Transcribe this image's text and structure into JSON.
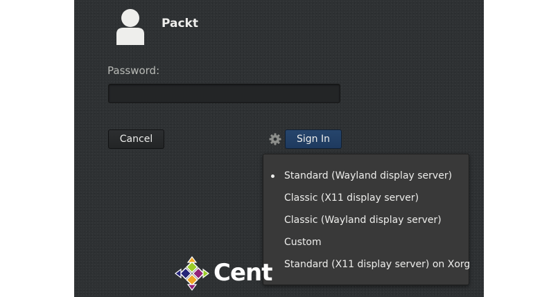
{
  "user": {
    "name": "Packt"
  },
  "password": {
    "label": "Password:",
    "value": "",
    "placeholder": ""
  },
  "buttons": {
    "cancel": "Cancel",
    "sign_in": "Sign In"
  },
  "session_menu": {
    "items": [
      {
        "label": "Standard (Wayland display server)",
        "selected": true
      },
      {
        "label": "Classic (X11 display server)",
        "selected": false
      },
      {
        "label": "Classic (Wayland display server)",
        "selected": false
      },
      {
        "label": "Custom",
        "selected": false
      },
      {
        "label": "Standard (X11 display server) on Xorg",
        "selected": false
      }
    ]
  },
  "branding": {
    "logo_text": "Cent"
  },
  "colors": {
    "background": "#2e3133",
    "menu_background": "#393939",
    "sign_in_button": "#1e3a5f",
    "text": "#eeeeec"
  },
  "icons": {
    "avatar": "user-silhouette-icon",
    "session": "gear-icon",
    "logo": "centos-logo-icon"
  }
}
